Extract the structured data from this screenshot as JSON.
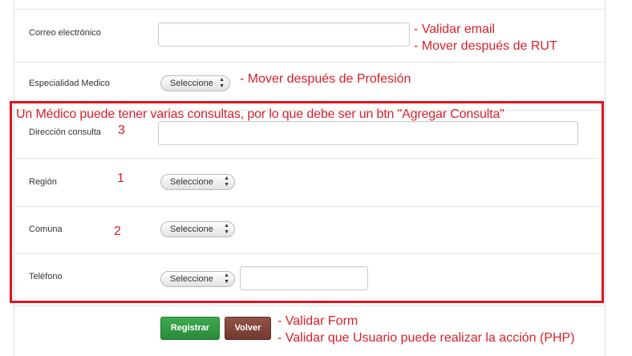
{
  "form": {
    "email_label": "Correo electrónico",
    "especialidad_label": "Especialidad Medico",
    "especialidad_select": "Seleccione",
    "direccion_label": "Dirección consulta",
    "region_label": "Región",
    "region_select": "Seleccione",
    "comuna_label": "Comuna",
    "comuna_select": "Seleccione",
    "telefono_label": "Teléfono",
    "telefono_select": "Seleccione",
    "arrows": "▲▼",
    "registrar_label": "Registrar",
    "volver_label": "Volver"
  },
  "annotations": {
    "email_note_1": "- Validar email",
    "email_note_2": "- Mover después de RUT",
    "especialidad_note": "- Mover después de Profesión",
    "consulta_note": "Un Médico puede tener varias consultas, por lo que debe ser un btn \"Agregar Consulta\"",
    "num_direccion": "3",
    "num_region": "1",
    "num_comuna": "2",
    "form_note_1": "- Validar Form",
    "form_note_2": "- Validar que Usuario puede realizar la acción (PHP)"
  },
  "colors": {
    "annotation_red": "#e3131f",
    "registrar_green": "#2f9a40",
    "volver_brown": "#7e4033"
  }
}
